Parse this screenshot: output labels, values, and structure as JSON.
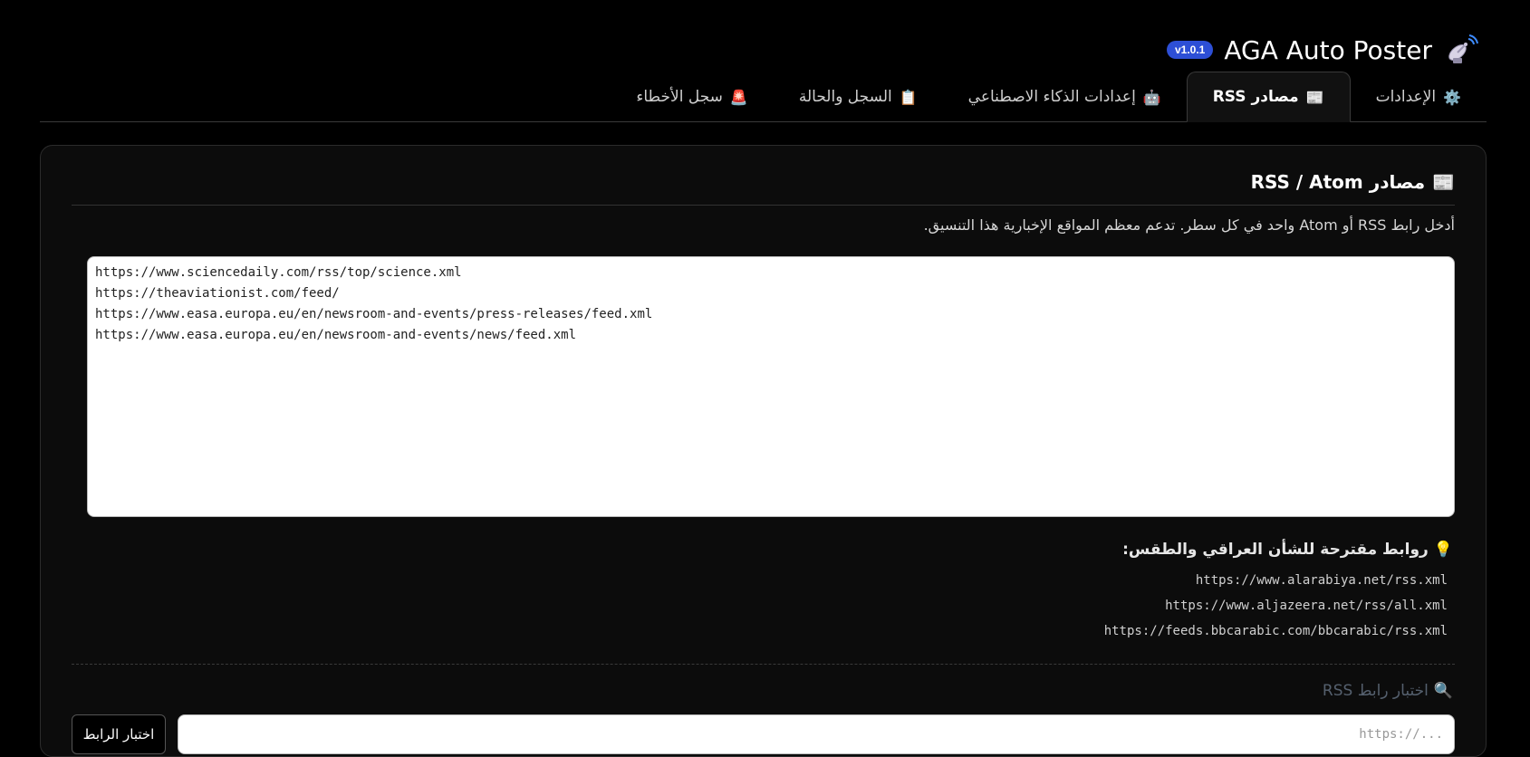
{
  "header": {
    "app_title": "AGA Auto Poster",
    "version": "v1.0.1",
    "logo_icon": "satellite-dish-icon"
  },
  "tabs": [
    {
      "label": "الإعدادات",
      "icon": "gear-icon",
      "emoji": "⚙️",
      "active": false
    },
    {
      "label": "مصادر RSS",
      "icon": "newspaper-icon",
      "emoji": "📰",
      "active": true
    },
    {
      "label": "إعدادات الذكاء الاصطناعي",
      "icon": "robot-icon",
      "emoji": "🤖",
      "active": false
    },
    {
      "label": "السجل والحالة",
      "icon": "clipboard-icon",
      "emoji": "📋",
      "active": false
    },
    {
      "label": "سجل الأخطاء",
      "icon": "siren-icon",
      "emoji": "🚨",
      "active": false
    }
  ],
  "rss_section": {
    "title": "مصادر RSS / Atom",
    "title_emoji": "📰",
    "description": "أدخل رابط RSS أو Atom واحد في كل سطر. تدعم معظم المواقع الإخبارية هذا التنسيق.",
    "feeds_text": "https://www.sciencedaily.com/rss/top/science.xml\nhttps://theaviationist.com/feed/\nhttps://www.easa.europa.eu/en/newsroom-and-events/press-releases/feed.xml\nhttps://www.easa.europa.eu/en/newsroom-and-events/news/feed.xml",
    "suggestions_title": "روابط مقترحة للشأن العراقي والطقس:",
    "suggestions_emoji": "💡",
    "suggestions": [
      "https://www.alarabiya.net/rss.xml",
      "https://www.aljazeera.net/rss/all.xml",
      "https://feeds.bbcarabic.com/bbcarabic/rss.xml"
    ]
  },
  "test_section": {
    "label": "اختبار رابط RSS",
    "label_emoji": "🔍",
    "input_placeholder": "https://...",
    "button_label": "اختبار الرابط"
  },
  "colors": {
    "background": "#000000",
    "panel": "#0c0c0c",
    "badge": "#2d4fd6",
    "muted_label": "#55606e"
  }
}
